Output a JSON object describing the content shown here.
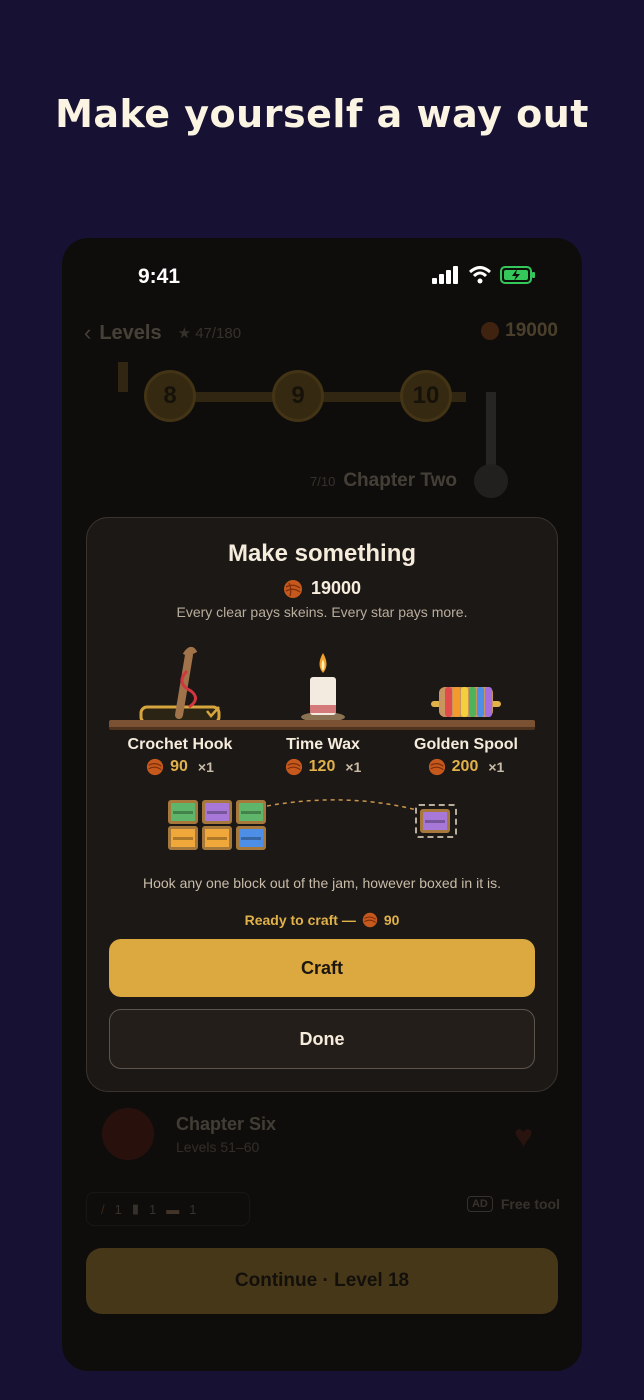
{
  "headline": "Make yourself a way out",
  "status_bar": {
    "time": "9:41"
  },
  "background_screen": {
    "back_label": "Levels",
    "stars": "★ 47/180",
    "balance": "19000",
    "level_nodes": [
      "8",
      "9",
      "10"
    ],
    "chapter_progress": "7/10",
    "chapter_title": "Chapter Two",
    "chapter6_title": "Chapter Six",
    "chapter6_subtitle": "Levels 51–60",
    "inventory_counts": [
      "1",
      "1",
      "1"
    ],
    "ad_badge": "AD",
    "free_tool_label": "Free tool",
    "continue_label": "Continue · Level 18"
  },
  "modal": {
    "title": "Make something",
    "balance": "19000",
    "subtitle": "Every clear pays skeins. Every star pays more.",
    "tools": [
      {
        "name": "Crochet Hook",
        "price": "90",
        "qty": "×1",
        "selected": true
      },
      {
        "name": "Time Wax",
        "price": "120",
        "qty": "×1",
        "selected": false
      },
      {
        "name": "Golden Spool",
        "price": "200",
        "qty": "×1",
        "selected": false
      }
    ],
    "description": "Hook any one block out of the jam, however boxed in it is.",
    "ready_prefix": "Ready to craft —",
    "ready_price": "90",
    "craft_label": "Craft",
    "done_label": "Done"
  },
  "colors": {
    "page_bg": "#171234",
    "accent_gold": "#dba93f",
    "modal_bg": "#1c1816"
  }
}
